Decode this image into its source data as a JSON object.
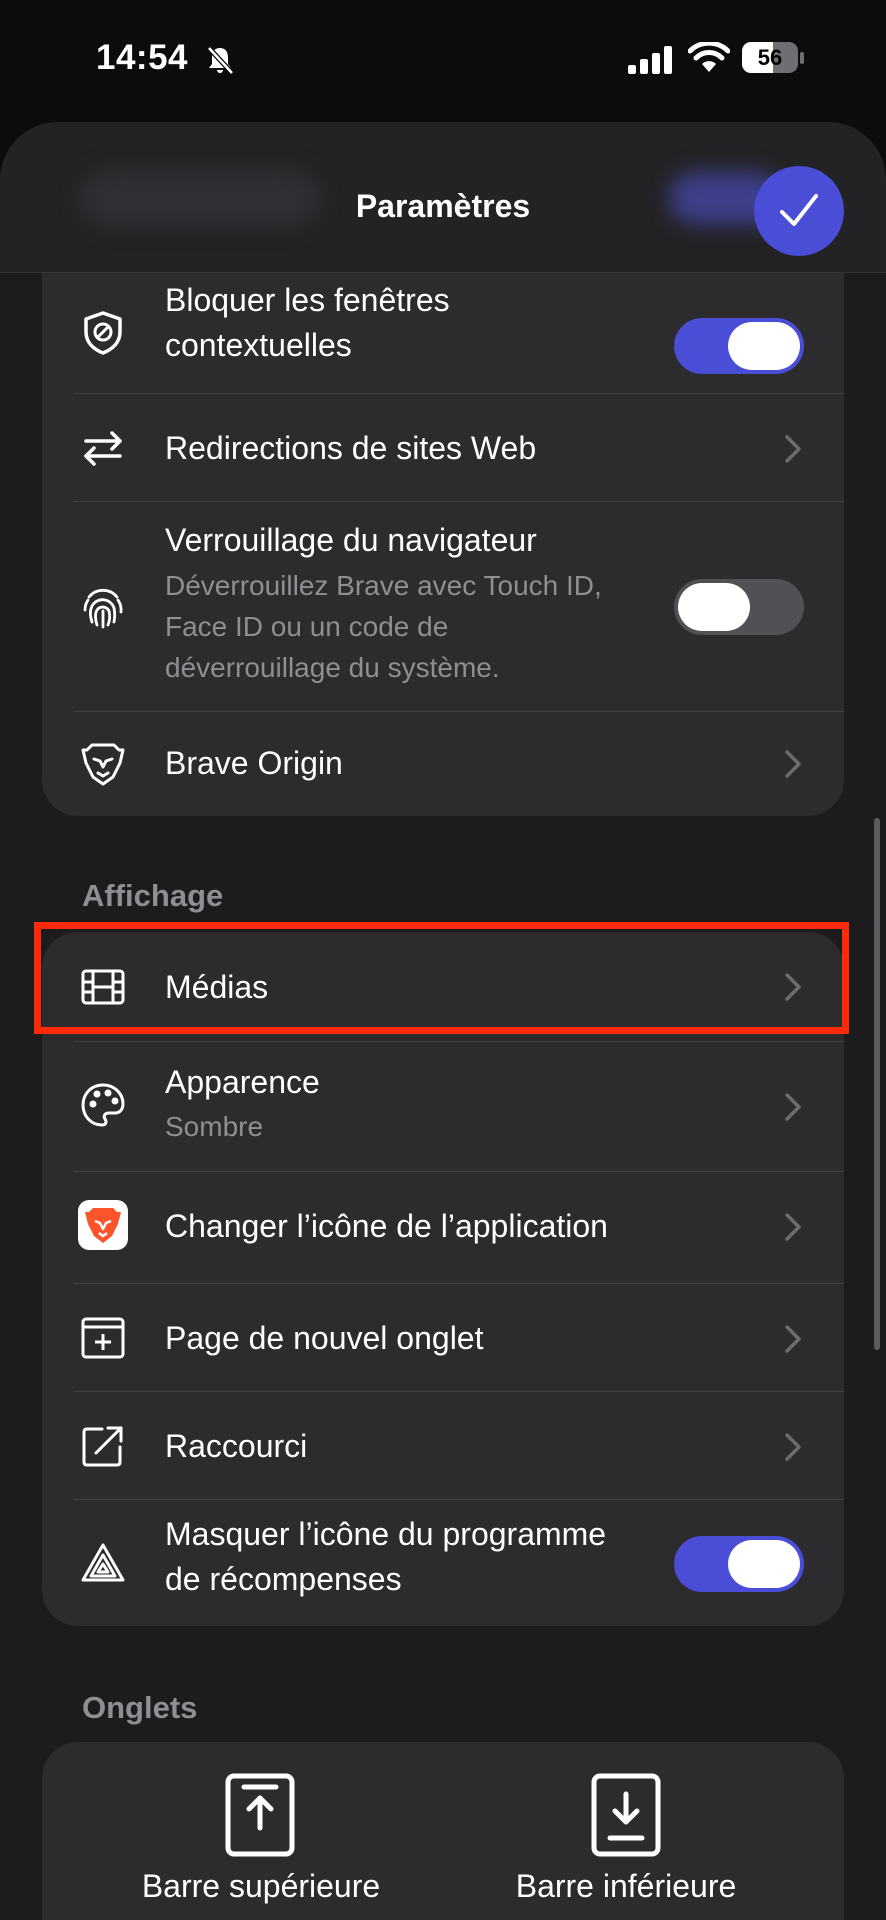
{
  "status_bar": {
    "time": "14:54",
    "battery_level": "56",
    "battery_fraction": 0.56,
    "icons": [
      "bell-slash-icon",
      "cellular-signal-icon",
      "wifi-icon",
      "battery-icon"
    ]
  },
  "nav": {
    "title": "Paramètres",
    "done_icon": "checkmark-icon"
  },
  "colors": {
    "accent": "#4a4dd6",
    "highlight": "#ff2a0a",
    "background": "#1c1c1f",
    "group_background": "#2c2c2e",
    "secondary_text": "#8e8e93"
  },
  "group_privacy": {
    "rows": [
      {
        "label_line1": "Bloquer les fenêtres",
        "label_line2": "contextuelles",
        "icon": "shield-block-icon",
        "control": "toggle",
        "toggle_on": true
      },
      {
        "label": "Redirections de sites Web",
        "icon": "arrows-left-right-icon",
        "control": "chevron"
      },
      {
        "label": "Verrouillage du navigateur",
        "sub_line1": "Déverrouillez Brave avec Touch ID,",
        "sub_line2": "Face ID ou un code de",
        "sub_line3": "déverrouillage du système.",
        "icon": "fingerprint-icon",
        "control": "toggle",
        "toggle_on": false
      },
      {
        "label": "Brave Origin",
        "icon": "brave-lion-icon",
        "control": "chevron"
      }
    ]
  },
  "section_display": {
    "header": "Affichage",
    "rows": [
      {
        "label": "Médias",
        "icon": "film-icon",
        "control": "chevron",
        "highlighted": true
      },
      {
        "label": "Apparence",
        "sub": "Sombre",
        "icon": "palette-icon",
        "control": "chevron"
      },
      {
        "label": "Changer l’icône de l’application",
        "icon": "brave-app-icon",
        "control": "chevron"
      },
      {
        "label": "Page de nouvel onglet",
        "icon": "new-tab-plus-icon",
        "control": "chevron"
      },
      {
        "label": "Raccourci",
        "icon": "external-arrow-icon",
        "control": "chevron"
      },
      {
        "label_line1": "Masquer l’icône du programme",
        "label_line2": "de récompenses",
        "icon": "rewards-triangle-icon",
        "control": "toggle",
        "toggle_on": true
      }
    ]
  },
  "section_tabs": {
    "header": "Onglets",
    "options": [
      {
        "label": "Barre supérieure",
        "icon": "top-bar-icon"
      },
      {
        "label": "Barre inférieure",
        "icon": "bottom-bar-icon"
      }
    ]
  }
}
